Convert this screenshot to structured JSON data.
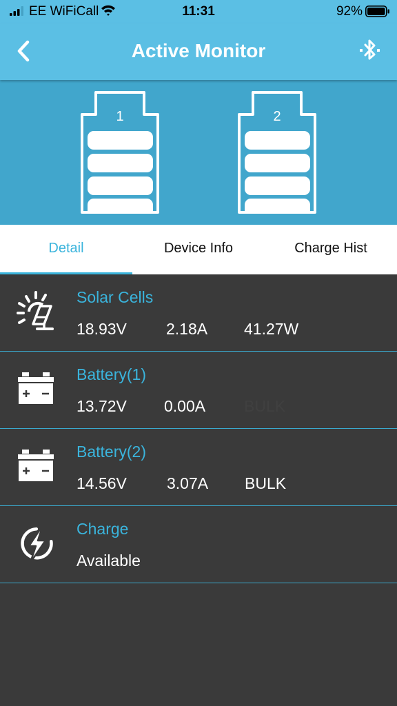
{
  "status_bar": {
    "carrier": "EE WiFiCall",
    "time": "11:31",
    "battery_percent": "92%",
    "battery_level": 0.92
  },
  "nav": {
    "title": "Active Monitor",
    "back_icon": "chevron-left-icon",
    "bluetooth_icon": "bluetooth-icon"
  },
  "hero": {
    "batteries": [
      {
        "label": "1"
      },
      {
        "label": "2"
      }
    ]
  },
  "tabs": [
    {
      "label": "Detail",
      "active": true
    },
    {
      "label": "Device Info",
      "active": false
    },
    {
      "label": "Charge Hist",
      "active": false
    }
  ],
  "rows": [
    {
      "label": "Solar Cells",
      "icon": "solar-panel-icon",
      "voltage": "18.93V",
      "current": "2.18A",
      "power": "41.27W"
    },
    {
      "label": "Battery(1)",
      "icon": "car-battery-icon",
      "voltage": "13.72V",
      "current": "0.00A",
      "mode": "BULK"
    },
    {
      "label": "Battery(2)",
      "icon": "car-battery-icon",
      "voltage": "14.56V",
      "current": "3.07A",
      "mode": "BULK"
    },
    {
      "label": "Charge",
      "icon": "lightning-icon",
      "status": "Available"
    }
  ],
  "colors": {
    "header": "#5bbfe4",
    "hero": "#41a6cc",
    "accent": "#3ab4dc",
    "background": "#3a3a3a"
  }
}
